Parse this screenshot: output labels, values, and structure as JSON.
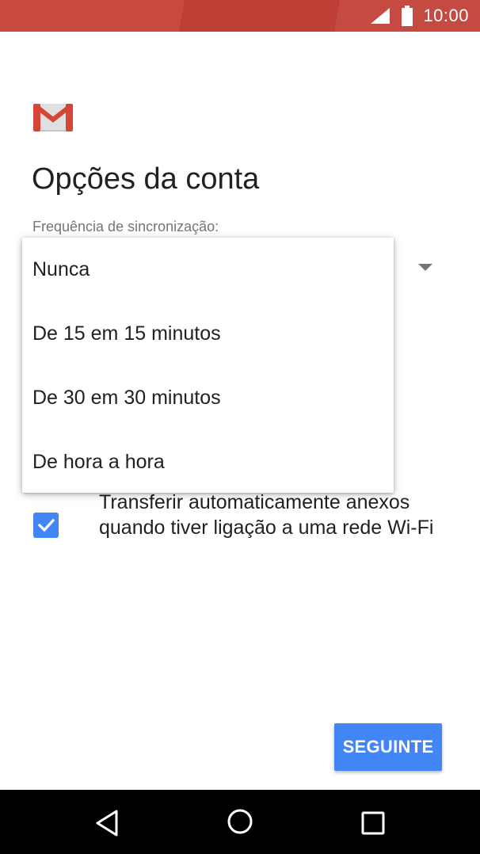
{
  "status_bar": {
    "time": "10:00",
    "icons": [
      "signal-icon",
      "battery-icon"
    ],
    "color": "#c5433a"
  },
  "app": {
    "logo": "gmail-logo"
  },
  "page": {
    "title": "Opções da conta",
    "sync_label": "Frequência de sincronização:"
  },
  "dropdown": {
    "options": [
      "Nunca",
      "De 15 em 15 minutos",
      "De 30 em 30 minutos",
      "De hora a hora"
    ]
  },
  "checkbox": {
    "checked": true,
    "label": "Transferir automaticamente anexos quando tiver ligação a uma rede Wi-Fi"
  },
  "next_button": {
    "label": "SEGUINTE",
    "color": "#4285f4"
  },
  "nav_bar": {
    "icons": [
      "back-icon",
      "home-icon",
      "recents-icon"
    ]
  }
}
